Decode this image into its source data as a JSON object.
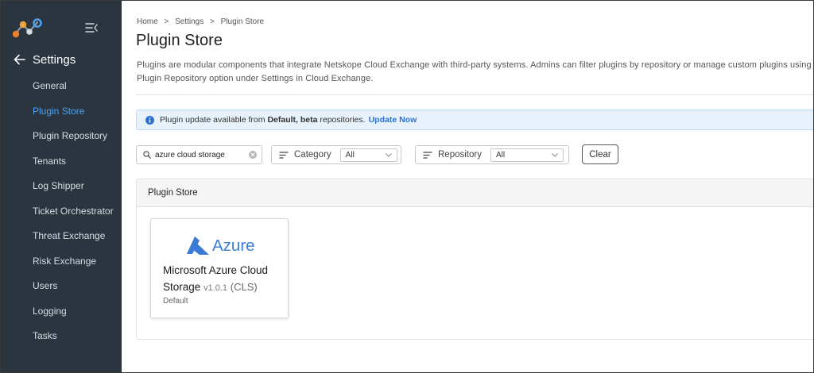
{
  "sidebar": {
    "section_title": "Settings",
    "items": [
      {
        "label": "General",
        "active": false
      },
      {
        "label": "Plugin Store",
        "active": true
      },
      {
        "label": "Plugin Repository",
        "active": false
      },
      {
        "label": "Tenants",
        "active": false
      },
      {
        "label": "Log Shipper",
        "active": false
      },
      {
        "label": "Ticket Orchestrator",
        "active": false
      },
      {
        "label": "Threat Exchange",
        "active": false
      },
      {
        "label": "Risk Exchange",
        "active": false
      },
      {
        "label": "Users",
        "active": false
      },
      {
        "label": "Logging",
        "active": false
      },
      {
        "label": "Tasks",
        "active": false
      }
    ]
  },
  "breadcrumb": {
    "items": [
      "Home",
      "Settings",
      "Plugin Store"
    ],
    "separator": ">"
  },
  "page": {
    "title": "Plugin Store",
    "description": "Plugins are modular components that integrate Netskope Cloud Exchange with third-party systems. Admins can filter plugins by repository or manage custom plugins using the Plugin Repository option under Settings in Cloud Exchange."
  },
  "banner": {
    "prefix": "Plugin update available from",
    "repos": "Default, beta",
    "suffix": "repositories.",
    "action": "Update Now"
  },
  "filters": {
    "search_value": "azure cloud storage",
    "category_label": "Category",
    "category_value": "All",
    "repository_label": "Repository",
    "repository_value": "All",
    "clear_label": "Clear"
  },
  "store": {
    "heading": "Plugin Store",
    "cards": [
      {
        "logo_text": "Azure",
        "name": "Microsoft Azure Cloud Storage",
        "version": "v1.0.1",
        "type": "(CLS)",
        "repository": "Default"
      }
    ]
  },
  "colors": {
    "sidebar_bg": "#2a3540",
    "active_nav": "#4aa3f2",
    "link": "#2a72d5",
    "azure_blue": "#3a7bd5"
  }
}
